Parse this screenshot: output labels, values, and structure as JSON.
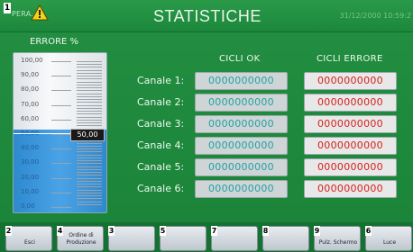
{
  "header": {
    "screen_number": "1",
    "oper_text": "PERA.",
    "title": "STATISTICHE",
    "datetime": "31/12/2000 10:59:2"
  },
  "gauge": {
    "label": "ERRORE %",
    "ticks": [
      "100,00",
      "90,00",
      "80,00",
      "70,00",
      "60,00",
      "50,00",
      "40,00",
      "30,00",
      "20,00",
      "10,00",
      "0,00"
    ],
    "value_text": "50,00",
    "value_percent": 50
  },
  "table": {
    "col_ok": "CICLI OK",
    "col_err": "CICLI ERRORE",
    "rows": [
      {
        "label": "Canale 1:",
        "ok": "0000000000",
        "err": "0000000000"
      },
      {
        "label": "Canale 2:",
        "ok": "0000000000",
        "err": "0000000000"
      },
      {
        "label": "Canale 3:",
        "ok": "0000000000",
        "err": "0000000000"
      },
      {
        "label": "Canale 4:",
        "ok": "0000000000",
        "err": "0000000000"
      },
      {
        "label": "Canale 5:",
        "ok": "0000000000",
        "err": "0000000000"
      },
      {
        "label": "Canale 6:",
        "ok": "0000000000",
        "err": "0000000000"
      }
    ]
  },
  "footer": [
    {
      "num": "2",
      "label": "Esci"
    },
    {
      "num": "4",
      "label": "Ordine di Produzione"
    },
    {
      "num": "3",
      "label": ""
    },
    {
      "num": "5",
      "label": ""
    },
    {
      "num": "7",
      "label": ""
    },
    {
      "num": "8",
      "label": ""
    },
    {
      "num": "9",
      "label": "Pulz. Schermo"
    },
    {
      "num": "6",
      "label": "Luce"
    }
  ],
  "colors": {
    "background": "#1c8a3a",
    "ok_text": "#20a3a3",
    "err_text": "#d4201f",
    "gauge_fill": "#3b97dd"
  }
}
